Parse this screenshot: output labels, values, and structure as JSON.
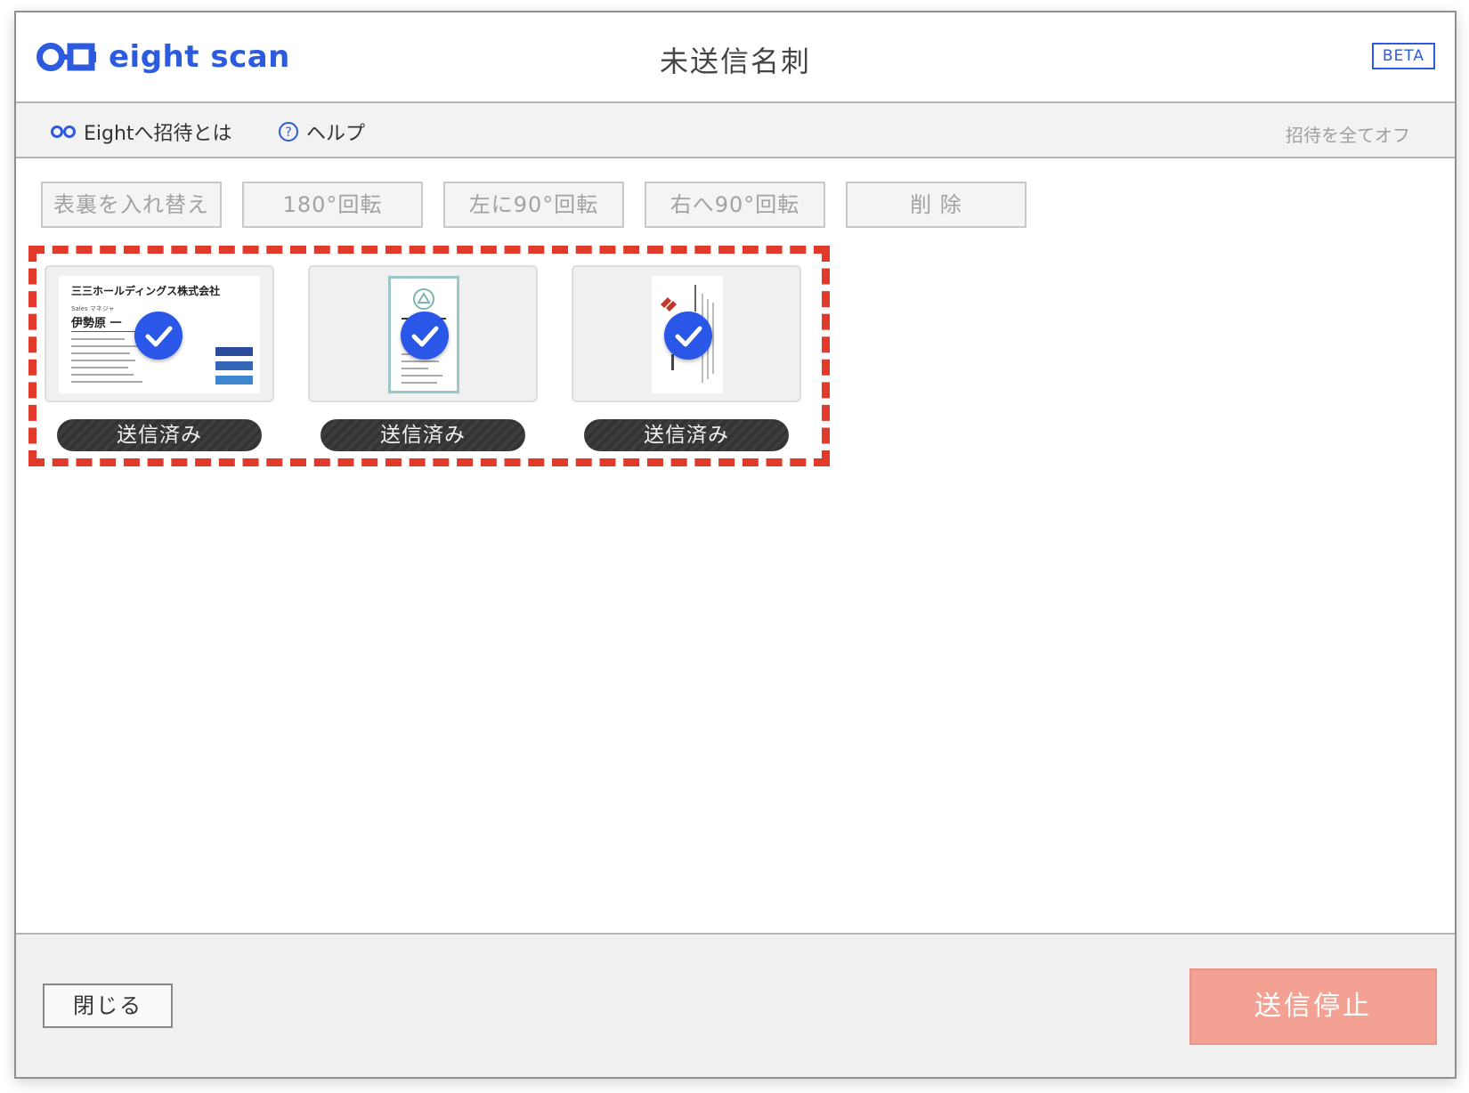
{
  "app": {
    "logo_text": "eight scan",
    "title": "未送信名刺",
    "beta_badge": "BETA"
  },
  "subbar": {
    "invite_link": "Eightへ招待とは",
    "help_link": "ヘルプ",
    "invite_all_off": "招待を全てオフ"
  },
  "toolbar": {
    "swap": "表裏を入れ替え",
    "rotate180": "180°回転",
    "rotate_left": "左に90°回転",
    "rotate_right": "右へ90°回転",
    "delete": "削 除"
  },
  "cards": [
    {
      "status": "送信済み",
      "company": "三三ホールディングス株式会社",
      "role": "Sales マネジャ",
      "name": "伊勢原 一"
    },
    {
      "status": "送信済み"
    },
    {
      "status": "送信済み"
    }
  ],
  "footer": {
    "close": "閉じる",
    "stop_sending": "送信停止"
  },
  "colors": {
    "brand": "#2c5be0",
    "selection": "#e23a2a",
    "stop_button": "#f2a192"
  }
}
